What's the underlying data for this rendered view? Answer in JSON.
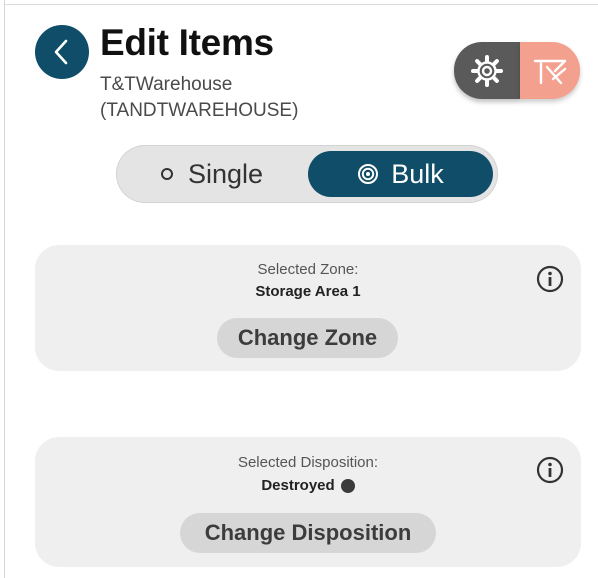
{
  "header": {
    "title": "Edit Items",
    "subtitle_line1": "T&TWarehouse",
    "subtitle_line2": "(TANDTWAREHOUSE)",
    "back_icon": "chevron-left-icon",
    "settings_icon": "gear-icon",
    "brand_icon": "brand-logo-icon"
  },
  "mode_toggle": {
    "options": [
      {
        "label": "Single",
        "icon": "radio-empty-icon",
        "selected": false
      },
      {
        "label": "Bulk",
        "icon": "radio-target-icon",
        "selected": true
      }
    ]
  },
  "zone_card": {
    "label": "Selected Zone:",
    "value": "Storage Area 1",
    "button_label": "Change Zone",
    "info_icon": "info-icon"
  },
  "disposition_card": {
    "label": "Selected Disposition:",
    "value": "Destroyed",
    "status_dot_color": "#3b3b3b",
    "button_label": "Change Disposition",
    "info_icon": "info-icon"
  },
  "colors": {
    "primary": "#0f4d68",
    "settings_bg": "#5a5a5a",
    "brand_bg": "#f4a08f",
    "card_bg": "#efefef",
    "button_bg": "#d6d6d6"
  }
}
